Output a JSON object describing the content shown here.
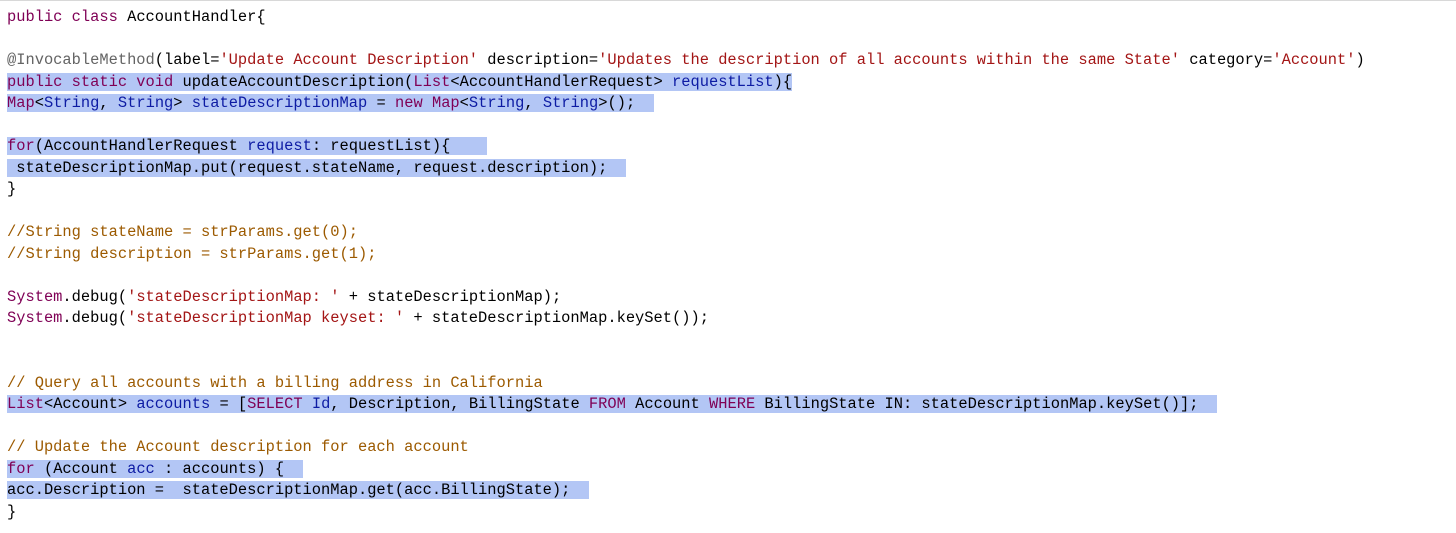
{
  "code": {
    "lines": [
      [
        {
          "t": "public class",
          "c": "kw"
        },
        {
          "t": " AccountHandler{",
          "c": ""
        }
      ],
      [],
      [
        {
          "t": "@InvocableMethod",
          "c": "an"
        },
        {
          "t": "(label=",
          "c": ""
        },
        {
          "t": "'Update Account Description'",
          "c": "st"
        },
        {
          "t": " description=",
          "c": ""
        },
        {
          "t": "'Updates the description of all accounts within the same State'",
          "c": "st"
        },
        {
          "t": " category=",
          "c": ""
        },
        {
          "t": "'Account'",
          "c": "st"
        },
        {
          "t": ")",
          "c": ""
        }
      ],
      [
        {
          "t": "public static void",
          "c": "kw",
          "hl": true
        },
        {
          "t": " updateAccountDescription(",
          "c": "",
          "hl": true
        },
        {
          "t": "List",
          "c": "kw",
          "hl": true
        },
        {
          "t": "<AccountHandlerRequest> ",
          "c": "",
          "hl": true
        },
        {
          "t": "requestList",
          "c": "id",
          "hl": true
        },
        {
          "t": "){",
          "c": "",
          "hl": true
        }
      ],
      [
        {
          "t": "Map",
          "c": "kw",
          "hl": true
        },
        {
          "t": "<",
          "c": "",
          "hl": true
        },
        {
          "t": "String",
          "c": "ty",
          "hl": true
        },
        {
          "t": ", ",
          "c": "",
          "hl": true
        },
        {
          "t": "String",
          "c": "ty",
          "hl": true
        },
        {
          "t": "> ",
          "c": "",
          "hl": true
        },
        {
          "t": "stateDescriptionMap",
          "c": "id",
          "hl": true
        },
        {
          "t": " = ",
          "c": "",
          "hl": true
        },
        {
          "t": "new",
          "c": "kw",
          "hl": true
        },
        {
          "t": " ",
          "c": "",
          "hl": true
        },
        {
          "t": "Map",
          "c": "kw",
          "hl": true
        },
        {
          "t": "<",
          "c": "",
          "hl": true
        },
        {
          "t": "String",
          "c": "ty",
          "hl": true
        },
        {
          "t": ", ",
          "c": "",
          "hl": true
        },
        {
          "t": "String",
          "c": "ty",
          "hl": true
        },
        {
          "t": ">();  ",
          "c": "",
          "hl": true
        }
      ],
      [],
      [
        {
          "t": "for",
          "c": "kw",
          "hl": true
        },
        {
          "t": "(AccountHandlerRequest ",
          "c": "",
          "hl": true
        },
        {
          "t": "request",
          "c": "id",
          "hl": true
        },
        {
          "t": ": requestList){    ",
          "c": "",
          "hl": true
        }
      ],
      [
        {
          "t": " stateDescriptionMap.put(request.stateName, request.description);  ",
          "c": "",
          "hl": true
        }
      ],
      [
        {
          "t": "}",
          "c": ""
        }
      ],
      [],
      [
        {
          "t": "//String stateName = strParams.get(0);",
          "c": "cm"
        }
      ],
      [
        {
          "t": "//String description = strParams.get(1);",
          "c": "cm"
        }
      ],
      [],
      [
        {
          "t": "System",
          "c": "kw"
        },
        {
          "t": ".debug(",
          "c": ""
        },
        {
          "t": "'stateDescriptionMap: '",
          "c": "st"
        },
        {
          "t": " + stateDescriptionMap);",
          "c": ""
        }
      ],
      [
        {
          "t": "System",
          "c": "kw"
        },
        {
          "t": ".debug(",
          "c": ""
        },
        {
          "t": "'stateDescriptionMap keyset: '",
          "c": "st"
        },
        {
          "t": " + stateDescriptionMap.keySet());",
          "c": ""
        }
      ],
      [],
      [],
      [
        {
          "t": "// Query all accounts with a billing address in California",
          "c": "cm"
        }
      ],
      [
        {
          "t": "List",
          "c": "kw",
          "hl": true
        },
        {
          "t": "<Account> ",
          "c": "",
          "hl": true
        },
        {
          "t": "accounts",
          "c": "id",
          "hl": true
        },
        {
          "t": " = [",
          "c": "",
          "hl": true
        },
        {
          "t": "SELECT",
          "c": "kw",
          "hl": true
        },
        {
          "t": " ",
          "c": "",
          "hl": true
        },
        {
          "t": "Id",
          "c": "id",
          "hl": true
        },
        {
          "t": ", Description, BillingState ",
          "c": "",
          "hl": true
        },
        {
          "t": "FROM",
          "c": "kw",
          "hl": true
        },
        {
          "t": " Account ",
          "c": "",
          "hl": true
        },
        {
          "t": "WHERE",
          "c": "kw",
          "hl": true
        },
        {
          "t": " BillingState IN: stateDescriptionMap.keySet()];  ",
          "c": "",
          "hl": true
        }
      ],
      [],
      [
        {
          "t": "// Update the Account description for each account",
          "c": "cm"
        }
      ],
      [
        {
          "t": "for",
          "c": "kw",
          "hl": true
        },
        {
          "t": " (Account ",
          "c": "",
          "hl": true
        },
        {
          "t": "acc",
          "c": "id",
          "hl": true
        },
        {
          "t": " : accounts) {  ",
          "c": "",
          "hl": true
        }
      ],
      [
        {
          "t": "acc.Description =  stateDescriptionMap.get(acc.BillingState);  ",
          "c": "",
          "hl": true
        }
      ],
      [
        {
          "t": "}",
          "c": ""
        }
      ]
    ]
  }
}
